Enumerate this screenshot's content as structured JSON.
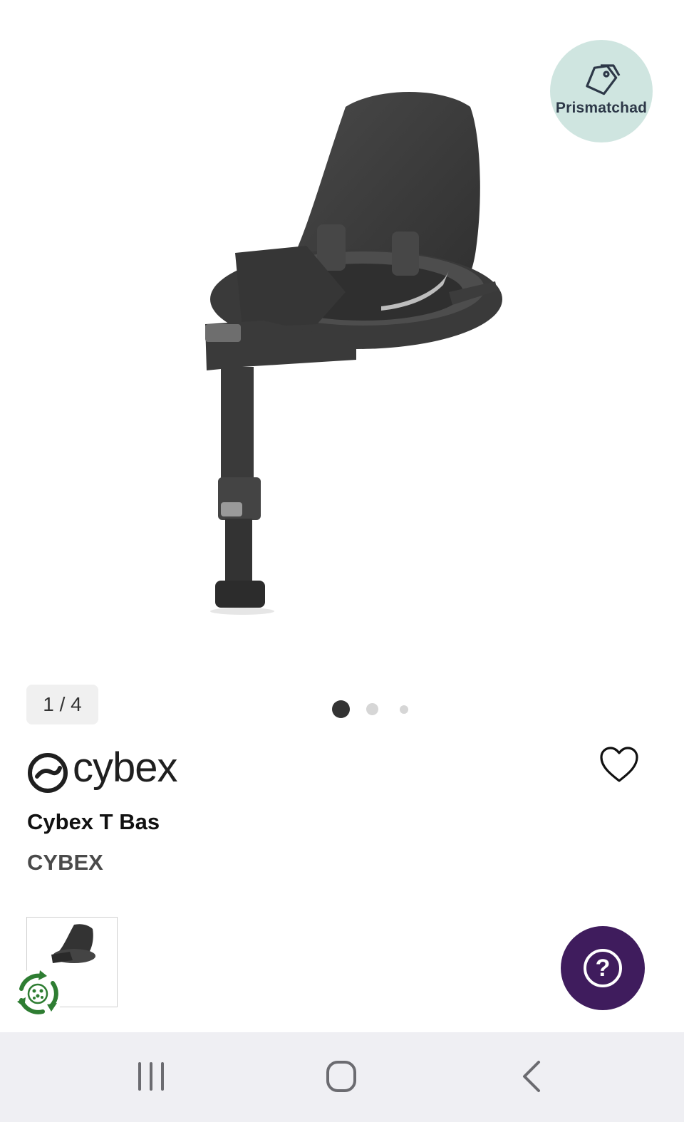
{
  "badge": {
    "label": "Prismatchad",
    "icon": "price-tag-icon"
  },
  "gallery": {
    "counter": "1 / 4",
    "dots": 3,
    "active_dot": 1
  },
  "brand_logo": {
    "text": "cybex"
  },
  "product": {
    "title": "Cybex T Bas",
    "brand": "CYBEX"
  },
  "icons": {
    "favorite": "heart-outline-icon",
    "help": "question-icon",
    "eco": "recycle-icon"
  },
  "colors": {
    "badge_bg": "#cfe5e0",
    "help_bg": "#3f1c5d",
    "eco_green": "#2e7d32",
    "navbar_bg": "#efeff3"
  }
}
